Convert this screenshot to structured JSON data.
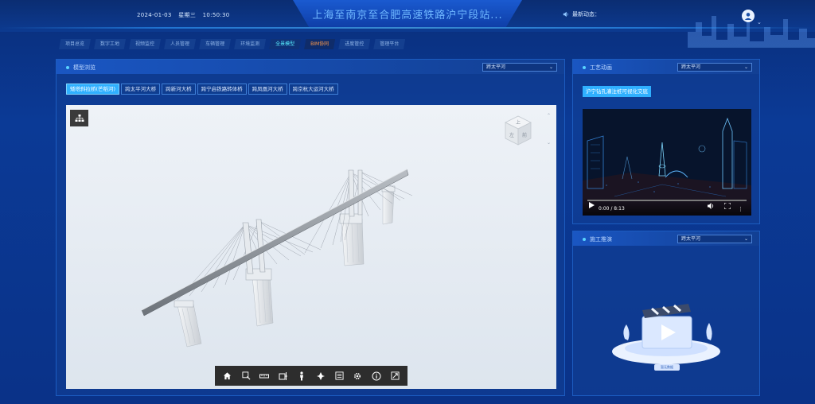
{
  "header": {
    "date": "2024-01-03",
    "weekday": "星期三",
    "time": "10:50:30",
    "title": "上海至南京至合肥高速铁路沪宁段站...",
    "notice_label": "最新动态："
  },
  "nav": {
    "tabs": [
      {
        "label": "项目总览",
        "state": "normal"
      },
      {
        "label": "数字工地",
        "state": "normal"
      },
      {
        "label": "视频监控",
        "state": "normal"
      },
      {
        "label": "人员管理",
        "state": "normal"
      },
      {
        "label": "车辆管理",
        "state": "normal"
      },
      {
        "label": "环境监测",
        "state": "normal"
      },
      {
        "label": "全景模型",
        "state": "active"
      },
      {
        "label": "BIM协同",
        "state": "highlight"
      },
      {
        "label": "进度管控",
        "state": "normal"
      },
      {
        "label": "管理平台",
        "state": "normal"
      }
    ]
  },
  "model_panel": {
    "title": "模型浏览",
    "select_value": "跨太平河",
    "bridge_tabs": [
      {
        "label": "矮塔斜拉桥(芒稻河)",
        "active": true
      },
      {
        "label": "跨太平河大桥",
        "active": false
      },
      {
        "label": "跨新河大桥",
        "active": false
      },
      {
        "label": "跨宁启铁路转体桥",
        "active": false
      },
      {
        "label": "跨凤凰河大桥",
        "active": false
      },
      {
        "label": "跨京杭大运河大桥",
        "active": false
      }
    ],
    "navcube": {
      "top": "上",
      "front": "左",
      "right": "前"
    },
    "toolbar_icons": [
      "home-icon",
      "zoom-window-icon",
      "measure-icon",
      "section-icon",
      "person-icon",
      "roam-icon",
      "properties-icon",
      "settings-icon",
      "info-icon",
      "fullscreen-icon"
    ]
  },
  "process_panel": {
    "title": "工艺动画",
    "select_value": "跨太平河",
    "video_tag": "沪宁钻孔灌注桩可视化交底",
    "video_time": "0:00 / 8:13",
    "progress": 0.0
  },
  "construction_panel": {
    "title": "施工推演",
    "select_value": "跨太平河",
    "empty_label": "暂无数据"
  },
  "colors": {
    "accent": "#2fb0ff",
    "title": "#6fb7ff",
    "bim_tab": "#ff9a4a",
    "active_tab": "#5af0ff"
  }
}
